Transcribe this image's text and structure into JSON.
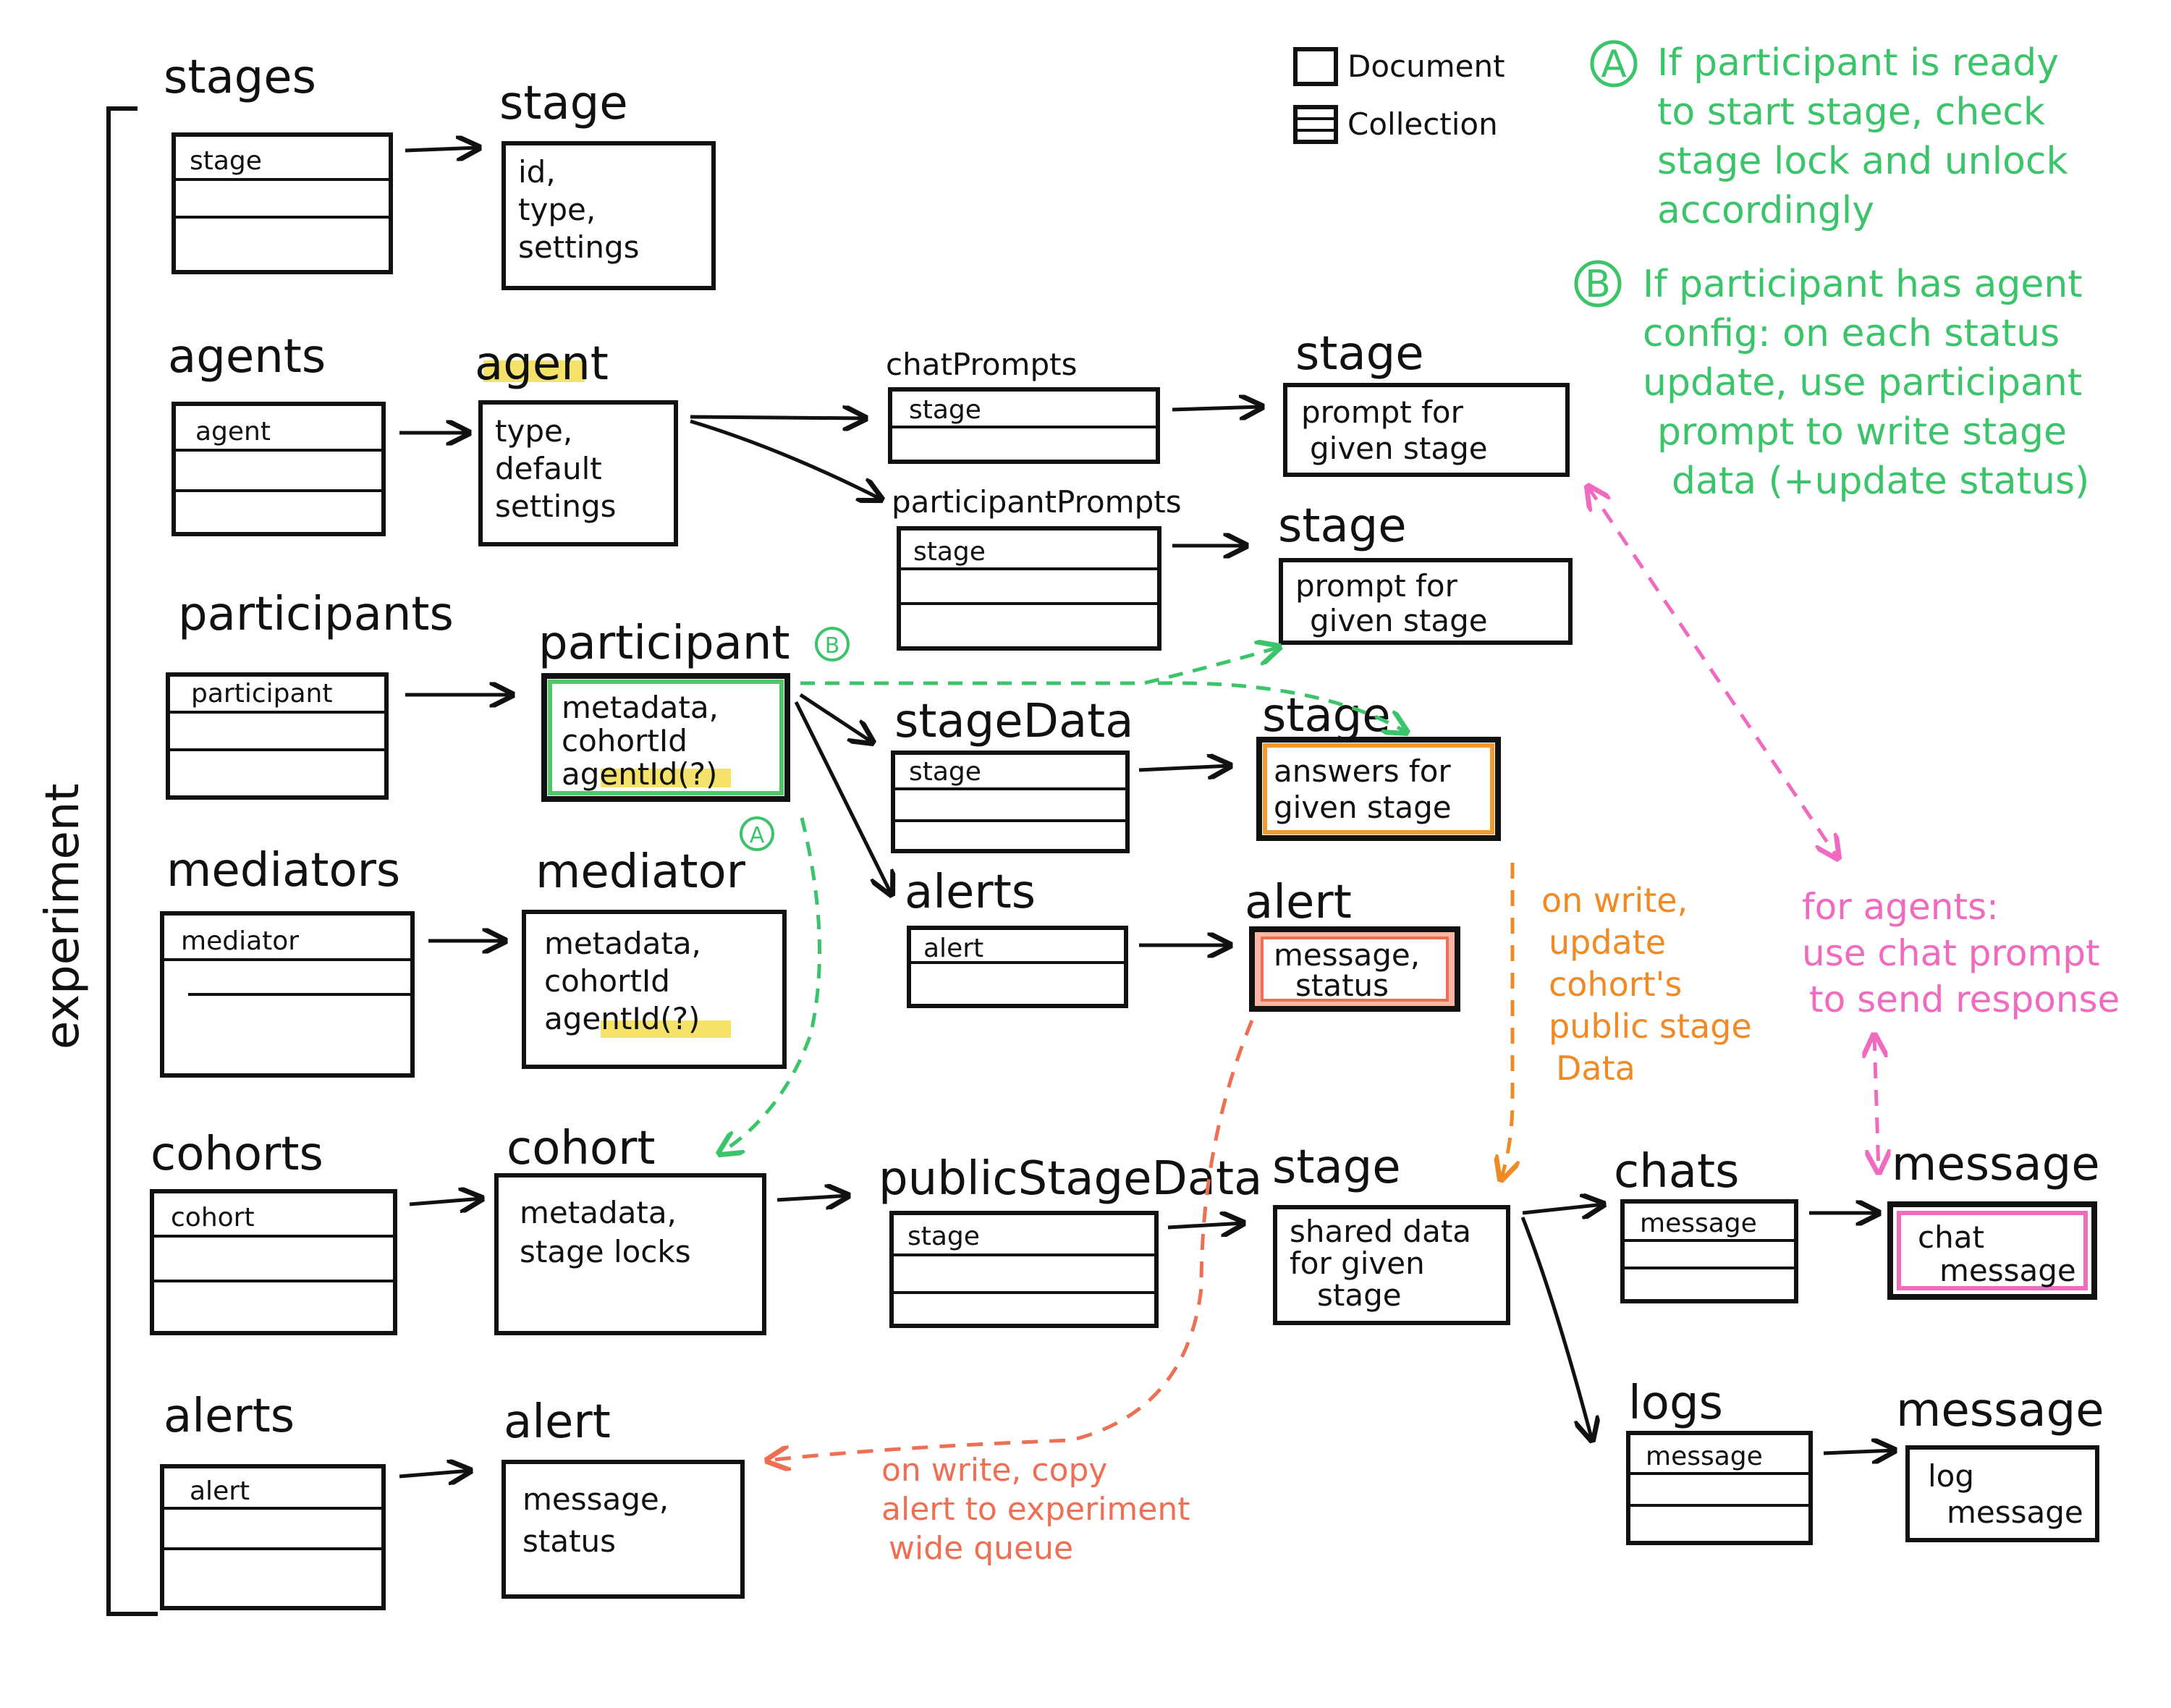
{
  "title": "experiment",
  "legend": {
    "document": "Document",
    "collection": "Collection"
  },
  "notes": {
    "a_marker": "A",
    "a_lines": [
      "If participant is ready",
      "to start stage, check",
      "stage lock and unlock",
      "accordingly"
    ],
    "b_marker": "B",
    "b_lines": [
      "If participant has agent",
      "config: on each status",
      "update, use participant",
      "prompt to write stage",
      "data (+update status)"
    ],
    "orange_lines": [
      "on write,",
      "update",
      "cohort's",
      "public stage",
      "Data"
    ],
    "pink_lines": [
      "for agents:",
      "use chat prompt",
      "to send response"
    ],
    "red_lines": [
      "on write, copy",
      "alert to experiment",
      "wide queue"
    ]
  },
  "collections": {
    "stages": {
      "title": "stages",
      "item": "stage"
    },
    "agents": {
      "title": "agents",
      "item": "agent"
    },
    "participants": {
      "title": "participants",
      "item": "participant"
    },
    "mediators": {
      "title": "mediators",
      "item": "mediator"
    },
    "cohorts": {
      "title": "cohorts",
      "item": "cohort"
    },
    "alerts": {
      "title": "alerts",
      "item": "alert"
    },
    "chatPrompts": {
      "title": "chatPrompts",
      "item": "stage"
    },
    "participantPrompts": {
      "title": "participantPrompts",
      "item": "stage"
    },
    "stageData": {
      "title": "stageData",
      "item": "stage"
    },
    "participantAlerts": {
      "title": "alerts",
      "item": "alert"
    },
    "publicStageData": {
      "title": "publicStageData",
      "item": "stage"
    },
    "chats": {
      "title": "chats",
      "item": "message"
    },
    "logs": {
      "title": "logs",
      "item": "message"
    }
  },
  "documents": {
    "stage": {
      "title": "stage",
      "lines": [
        "id,",
        "type,",
        "settings"
      ]
    },
    "agent": {
      "title": "agent",
      "lines": [
        "type,",
        "default",
        "settings"
      ]
    },
    "participant": {
      "title": "participant",
      "lines": [
        "metadata,",
        "cohortId",
        "agentId(?)"
      ]
    },
    "mediator": {
      "title": "mediator",
      "lines": [
        "metadata,",
        "cohortId",
        "agentId(?)"
      ]
    },
    "cohort": {
      "title": "cohort",
      "lines": [
        "metadata,",
        "stage locks"
      ]
    },
    "alert": {
      "title": "alert",
      "lines": [
        "message,",
        "status"
      ]
    },
    "chatPromptStage": {
      "title": "stage",
      "lines": [
        "prompt for",
        "given stage"
      ]
    },
    "participantPromptStage": {
      "title": "stage",
      "lines": [
        "prompt for",
        "given stage"
      ]
    },
    "stageDataStage": {
      "title": "stage",
      "lines": [
        "answers for",
        "given stage"
      ]
    },
    "participantAlert": {
      "title": "alert",
      "lines": [
        "message,",
        "status"
      ]
    },
    "publicStage": {
      "title": "stage",
      "lines": [
        "shared data",
        "for given",
        "stage"
      ]
    },
    "chatMessage": {
      "title": "message",
      "lines": [
        "chat",
        "message"
      ]
    },
    "logMessage": {
      "title": "message",
      "lines": [
        "log",
        "message"
      ]
    }
  },
  "colors": {
    "ink": "#111111",
    "green": "#3cc46a",
    "orange": "#f08a24",
    "red": "#ef6f55",
    "pink": "#f06ac0",
    "highlight_yellow": "#f4e26b",
    "alert_fill": "#f7b7a3",
    "orange_border": "#f39a2e",
    "pink_border": "#f06ac0",
    "green_border": "#4fc768"
  }
}
